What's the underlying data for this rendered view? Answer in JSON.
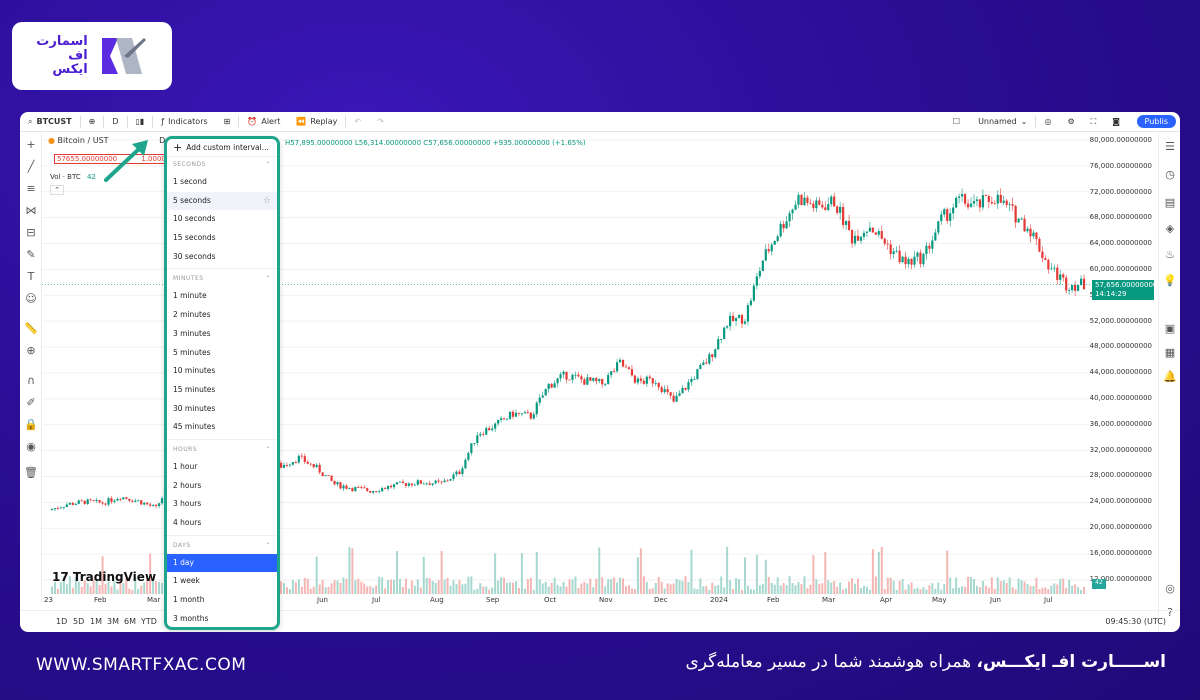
{
  "brand": {
    "logo_text_lines": [
      "اسمارت",
      "اف",
      "ایکس"
    ],
    "website": "WWW.SMARTFXAC.COM",
    "tagline_bold": "اســـــارت افـ ایکـــس،",
    "tagline_rest": " همراه هوشمند شما در مسیر معامله‌گری"
  },
  "toolbar": {
    "symbol": "BTCUST",
    "interval": "D",
    "indicators": "Indicators",
    "alert": "Alert",
    "replay": "Replay",
    "layout_name": "Unnamed",
    "publish": "Publis"
  },
  "legend": {
    "title": "Bitcoin / UST",
    "title_tail": "D · BIT",
    "ohlc": "H57,895.00000000  L56,314.00000000  C57,656.00000000  +935.00000000 (+1.65%)",
    "price_box": "57655.00000000",
    "price_box_tail": "1.00000000",
    "volume": "Vol · BTC",
    "volume_value": "42"
  },
  "interval_menu": {
    "add_custom": "Add custom interval...",
    "sections": [
      {
        "title": "SECONDS",
        "items": [
          "1 second",
          "5 seconds",
          "10 seconds",
          "15 seconds",
          "30 seconds"
        ]
      },
      {
        "title": "MINUTES",
        "items": [
          "1 minute",
          "2 minutes",
          "3 minutes",
          "5 minutes",
          "10 minutes",
          "15 minutes",
          "30 minutes",
          "45 minutes"
        ]
      },
      {
        "title": "HOURS",
        "items": [
          "1 hour",
          "2 hours",
          "3 hours",
          "4 hours"
        ]
      },
      {
        "title": "DAYS",
        "items": [
          "1 day",
          "1 week",
          "1 month",
          "3 months"
        ]
      }
    ],
    "selected": "1 day",
    "hovered": "5 seconds"
  },
  "y_axis_labels": [
    "80,000.00000000",
    "76,000.00000000",
    "72,000.00000000",
    "68,000.00000000",
    "64,000.00000000",
    "60,000.00000000",
    "56,000.00000000",
    "52,000.00000000",
    "48,000.00000000",
    "44,000.00000000",
    "40,000.00000000",
    "36,000.00000000",
    "32,000.00000000",
    "28,000.00000000",
    "24,000.00000000",
    "20,000.00000000",
    "16,000.00000000",
    "12,000.00000000"
  ],
  "current_price": {
    "value": "57,656.00000000",
    "countdown": "14:14:29",
    "color": "#089981"
  },
  "volume_badge": "42",
  "x_axis_labels": [
    "23",
    "Feb",
    "Mar",
    "Jun",
    "Jul",
    "Aug",
    "Sep",
    "Oct",
    "Nov",
    "Dec",
    "2024",
    "Feb",
    "Mar",
    "Apr",
    "May",
    "Jun",
    "Jul"
  ],
  "timeframes": [
    "1D",
    "5D",
    "1M",
    "3M",
    "6M",
    "YTD"
  ],
  "clock": "09:45:30 (UTC)",
  "tradingview": "TradingView",
  "colors": {
    "up": "#089981",
    "down": "#e53935",
    "accent": "#1ea58c",
    "background": "#2a0e96"
  },
  "chart_data": {
    "type": "candlestick",
    "series": [
      {
        "name": "",
        "close": [
          22800,
          23700,
          24100,
          23900,
          24900,
          24200,
          23100,
          28000,
          29300,
          30200,
          30100,
          30600,
          30200,
          29600,
          30900,
          29300,
          26800,
          26200,
          25800,
          26400,
          26900,
          27100,
          26900,
          28700,
          34600,
          35900,
          37700,
          37300,
          42100,
          43700,
          42800,
          42300,
          45500,
          42600,
          42900,
          39500,
          43000,
          46300,
          51800,
          52600,
          61500,
          66500,
          71100,
          69600,
          70500,
          64900,
          66800,
          63700,
          60900,
          62000,
          67600,
          70700,
          69800,
          71200,
          68800,
          66100,
          60600,
          57700,
          57656
        ]
      }
    ],
    "ylim": [
      12000,
      80000
    ],
    "grid": true,
    "legend": "top-left"
  }
}
